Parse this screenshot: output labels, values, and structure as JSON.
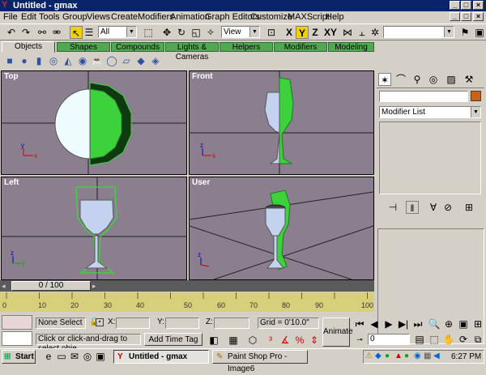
{
  "window": {
    "title": "Untitled - gmax"
  },
  "menu": [
    "File",
    "Edit",
    "Tools",
    "Group",
    "Views",
    "Create",
    "Modifiers",
    "Animation",
    "Graph Editors",
    "Customize",
    "MAXScript",
    "Help"
  ],
  "toolbar": {
    "selection_filter": "All",
    "ref_coord": "View",
    "axis_x": "X",
    "axis_y": "Y",
    "axis_z": "Z",
    "axis_xy": "XY"
  },
  "tabs": [
    "Objects",
    "Shapes",
    "Compounds",
    "Lights & Cameras",
    "Helpers",
    "Modifiers",
    "Modeling"
  ],
  "active_tab": "Objects",
  "viewports": {
    "top": "Top",
    "front": "Front",
    "left": "Left",
    "user": "User"
  },
  "command_panel": {
    "modifier_list": "Modifier List",
    "name_value": ""
  },
  "timeline": {
    "frame_label": "0 / 100",
    "ticks": [
      "0",
      "10",
      "20",
      "30",
      "40",
      "50",
      "60",
      "70",
      "80",
      "90",
      "100"
    ]
  },
  "status": {
    "selection": "None Select",
    "prompt": "Click or click-and-drag to select obje",
    "add_time_tag": "Add Time Tag",
    "x_label": "X:",
    "y_label": "Y:",
    "z_label": "Z:",
    "x_value": "",
    "y_value": "",
    "z_value": "",
    "grid": "Grid = 0'10.0\"",
    "animate": "Animate",
    "frame_value": "0"
  },
  "taskbar": {
    "start": "Start",
    "tasks": [
      "Untitled - gmax",
      "Paint Shop Pro - Image6"
    ],
    "clock": "6:27 PM"
  },
  "colors": {
    "accent_green": "#52a852",
    "viewport_bg": "#8b7f8f",
    "title_blue": "#0a246a",
    "selection_green": "#3cd23c"
  }
}
